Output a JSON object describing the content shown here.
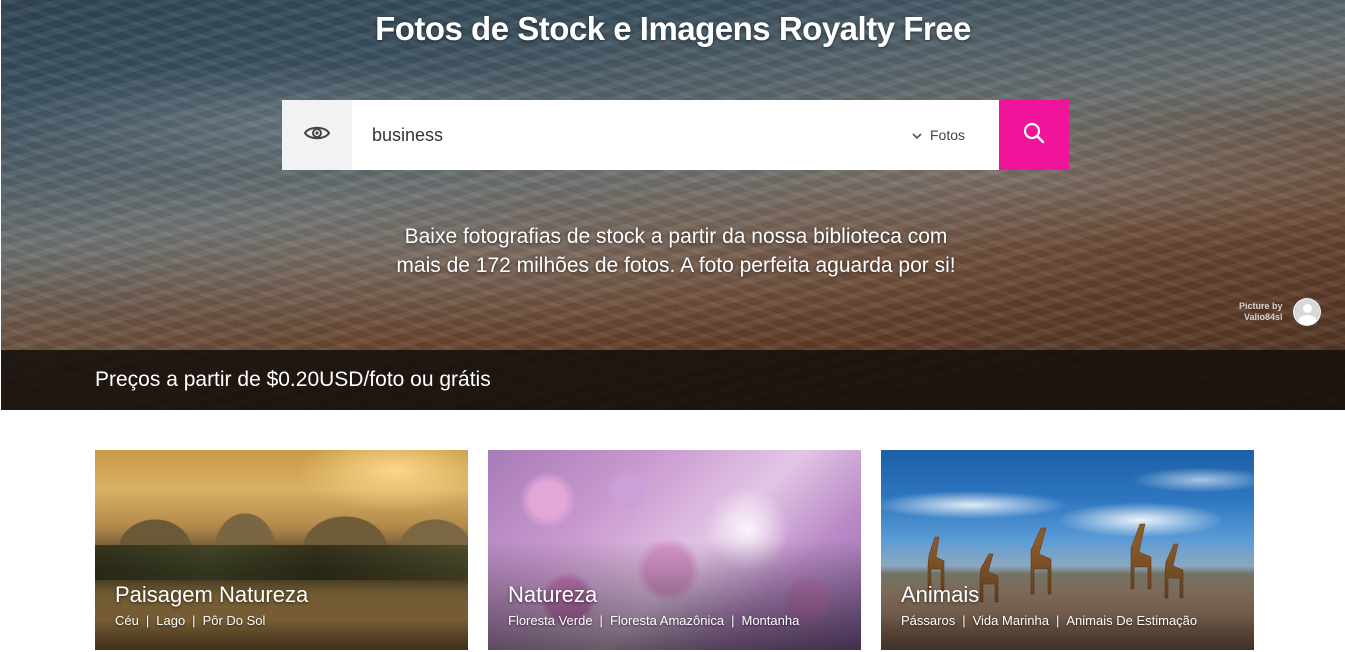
{
  "hero": {
    "title": "Fotos de Stock e Imagens Royalty Free",
    "tagline": "Baixe fotografias de stock a partir da nossa biblioteca com mais de 172 milhões de fotos. A foto perfeita aguarda por si!",
    "credit_line1": "Picture by",
    "credit_line2": "Valio84sl",
    "pricing": "Preços a partir de $0.20USD/foto ou grátis"
  },
  "search": {
    "value": "business",
    "type_label": "Fotos",
    "accent": "#f0149a"
  },
  "cards": [
    {
      "title": "Paisagem Natureza",
      "links": [
        "Céu",
        "Lago",
        "Pôr Do Sol"
      ]
    },
    {
      "title": "Natureza",
      "links": [
        "Floresta Verde",
        "Floresta Amazônica",
        "Montanha"
      ]
    },
    {
      "title": "Animais",
      "links": [
        "Pássaros",
        "Vida Marinha",
        "Animais De Estimação"
      ]
    }
  ],
  "icons": {
    "visual_search": "eye-icon",
    "dropdown": "chevron-down-icon",
    "search": "search-icon",
    "avatar": "user-avatar-icon"
  }
}
